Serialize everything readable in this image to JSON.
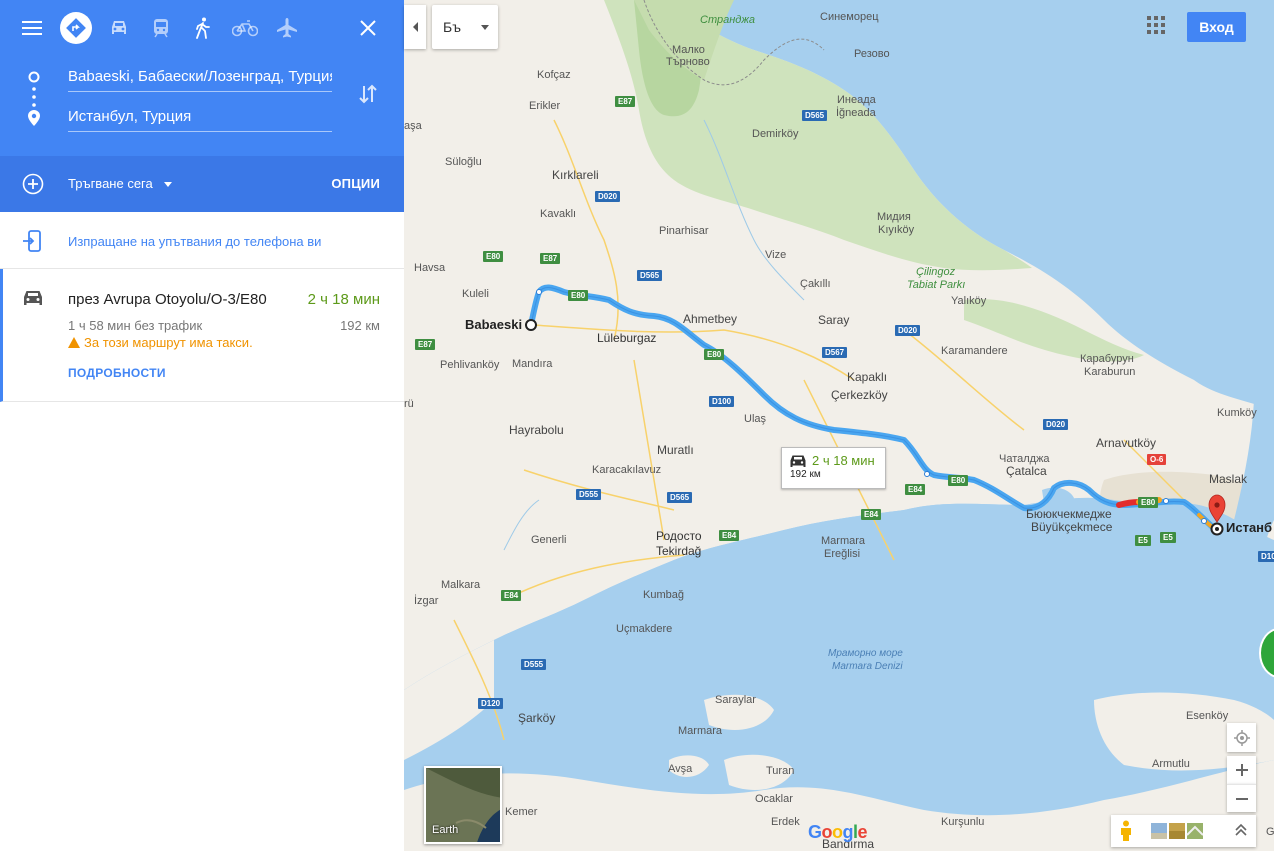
{
  "panel": {
    "travel_modes": [
      "menu",
      "best-route",
      "driving",
      "transit",
      "walking",
      "cycling",
      "flights"
    ],
    "origin": "Babaeski, Бабаески/Лозенград, Турция",
    "destination": "Истанбул, Турция",
    "depart_label": "Тръгване сега",
    "options_label": "ОПЦИИ",
    "send_to_phone": "Изпращане на упътвания до телефона ви"
  },
  "route": {
    "via": "през Avrupa Otoyolu/O-3/E80",
    "duration": "2 ч 18 мин",
    "without_traffic": "1 ч 58 мин без трафик",
    "distance": "192 км",
    "warning": "За този маршрут има такси.",
    "details_label": "ПОДРОБНОСТИ"
  },
  "map": {
    "language_button": "Бъ",
    "signin_label": "Вход",
    "earth_label": "Earth",
    "google_logo": "Google",
    "callout": {
      "time": "2 ч 18 мин",
      "distance": "192 км"
    },
    "origin_label": "Babaeski",
    "destination_label": "Истанб",
    "towns": {
      "strandzha": "Странджа",
      "sinemorets": "Синеморец",
      "malko_tarnovo_1": "Малко",
      "malko_tarnovo_2": "Търново",
      "rezovo": "Резово",
      "kofcaz": "Kofçaz",
      "erikler": "Erikler",
      "aca": "aşa",
      "demirkoy": "Demirköy",
      "ineada_1": "Инеада",
      "ineada_2": "İğneada",
      "suloglu": "Süloğlu",
      "kirklareli": "Kırklareli",
      "kavakli": "Kavaklı",
      "midiya_1": "Мидия",
      "midiya_2": "Kıyıköy",
      "pinarhisar": "Pinarhisar",
      "havsa": "Havsa",
      "vize": "Vize",
      "cilingoz_1": "Çilingoz",
      "cilingoz_2": "Tabiat Parkı",
      "kuleli": "Kuleli",
      "cakilli": "Çakıllı",
      "yalikoy": "Yalıköy",
      "ahmetbey": "Ahmetbey",
      "saray": "Saray",
      "luleburgaz": "Lüleburgaz",
      "karamandere": "Karamandere",
      "karaburun_1": "Карабурун",
      "karaburun_2": "Karaburun",
      "pehlivankoy": "Pehlivanköy",
      "mandira": "Mandıra",
      "kapakli": "Kapaklı",
      "cerkezkoy": "Çerkezköy",
      "ru": "rü",
      "ulas": "Ulaş",
      "kumkoy": "Kumköy",
      "hayrabolu": "Hayrabolu",
      "arnavutkoy": "Arnavutköy",
      "muratli": "Muratlı",
      "catalca_1": "Чаталджа",
      "catalca_2": "Çatalca",
      "maslak": "Maslak",
      "karacakilavuz": "Karacakılavuz",
      "buyukcekmece_1": "Бююкчекмедже",
      "buyukcekmece_2": "Büyükçekmece",
      "generli": "Generli",
      "tekirdag_1": "Родосто",
      "tekirdag_2": "Tekirdağ",
      "marmara_ereglisi_1": "Marmara",
      "marmara_ereglisi_2": "Ereğlisi",
      "malkara": "Malkara",
      "izgar": "İzgar",
      "kumbag": "Kumbağ",
      "ucmakdere": "Uçmakdere",
      "sea_1": "Мраморно море",
      "sea_2": "Marmara Denizi",
      "saraylar": "Saraylar",
      "sarkoy": "Şarköy",
      "esenkoy": "Esenköy",
      "marmara": "Marmara",
      "avsa": "Avşa",
      "armutlu": "Armutlu",
      "turan": "Turan",
      "ocaklar": "Ocaklar",
      "kemer": "Kemer",
      "erdek": "Erdek",
      "bandirma": "Bandırma",
      "kursunlu": "Kurşunlu",
      "gemlik": "Ge"
    },
    "shields": {
      "e87_1": "E87",
      "d565_1": "D565",
      "d020_1": "D020",
      "e80_1": "E80",
      "e87_2": "E87",
      "d565_2": "D565",
      "e80_2": "E80",
      "e87_3": "E87",
      "d020_2": "D020",
      "d567": "D567",
      "e80_3": "E80",
      "d100_1": "D100",
      "d020_3": "D020",
      "o6": "O-6",
      "e84_1": "E84",
      "e80_4": "E80",
      "e80_5": "E80",
      "d555_1": "D555",
      "d565_3": "D565",
      "e84_2": "E84",
      "e84_3": "E84",
      "e5_1": "E5",
      "e5_2": "E5",
      "d100_2": "D10",
      "e84_4": "E84",
      "d555_2": "D555",
      "d120": "D120"
    }
  },
  "colors": {
    "header_blue": "#4285f4",
    "options_blue": "#3b78e7",
    "route_blue": "#4aa6f0",
    "traffic_green": "#5d9a1a",
    "warning_orange": "#f09300"
  }
}
